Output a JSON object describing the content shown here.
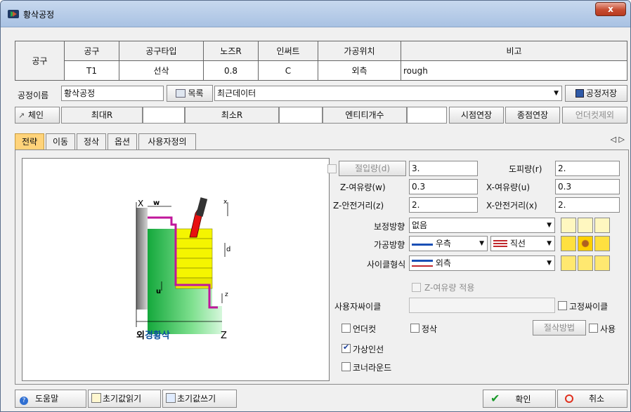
{
  "window": {
    "title": "황삭공정",
    "close_label": "x"
  },
  "tool": {
    "row_label": "공구",
    "headers": [
      "공구",
      "공구타입",
      "노즈R",
      "인써트",
      "가공위치",
      "비고"
    ],
    "values": [
      "T1",
      "선삭",
      "0.8",
      "C",
      "외측",
      "rough"
    ]
  },
  "process": {
    "name_label": "공정이름",
    "name_value": "황삭공정",
    "list_button": "목록",
    "recent_value": "최근데이터",
    "save_button": "공정저장"
  },
  "chain": {
    "chain_button": "체인",
    "max_r_label": "최대R",
    "min_r_label": "최소R",
    "entity_count_label": "엔티티개수",
    "start_extend_button": "시점연장",
    "end_extend_button": "종점연장",
    "undercut_exclude_button": "언더컷제외"
  },
  "tabs": [
    "전략",
    "이동",
    "정삭",
    "옵션",
    "사용자정의"
  ],
  "tab_arrows": "◁ ▷",
  "diagram": {
    "x_label": "X",
    "w_label": "w",
    "x_small": "x",
    "d_label": "d",
    "u_label": "u",
    "z_small": "z",
    "caption_prefix": "외",
    "caption_main": "경황삭",
    "z_label": "Z"
  },
  "params": {
    "depth_label": "절입량(d)",
    "depth_value": "3.",
    "retract_label": "도피량(r)",
    "retract_value": "2.",
    "z_allow_label": "Z-여유량(w)",
    "z_allow_value": "0.3",
    "x_allow_label": "X-여유량(u)",
    "x_allow_value": "0.3",
    "z_safe_label": "Z-안전거리(z)",
    "z_safe_value": "2.",
    "x_safe_label": "X-안전거리(x)",
    "x_safe_value": "2.",
    "comp_label": "보정방향",
    "comp_value": "없음",
    "dir_label": "가공방향",
    "dir_value": "우측",
    "dir_type_value": "직선",
    "cycle_label": "사이클형식",
    "cycle_value": "외측",
    "z_allow_apply_label": "Z-여유량 적용",
    "user_cycle_label": "사용자싸이클",
    "fixed_cycle_label": "고정싸이클",
    "undercut_label": "언더컷",
    "finish_label": "정삭",
    "cut_method_button": "절삭방법",
    "use_label": "사용",
    "virtual_insert_label": "가상인선",
    "corner_round_label": "코너라운드"
  },
  "bottom": {
    "help": "도움말",
    "read_defaults": "초기값읽기",
    "write_defaults": "초기값쓰기",
    "ok": "확인",
    "cancel": "취소"
  },
  "colors": {
    "active_tab": "#ffd37a",
    "part_green": "#2ecc5a",
    "stock_yellow": "#f5f500",
    "profile_magenta": "#c0169b"
  }
}
